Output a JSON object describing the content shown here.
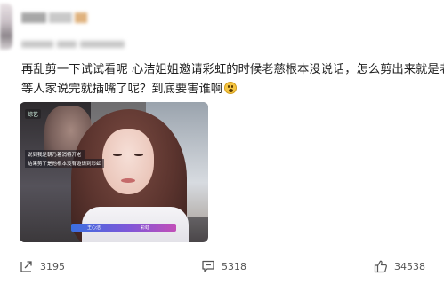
{
  "post": {
    "text_lines": [
      "再乱剪一下试试看呢 心洁姐姐邀请彩虹的时候老慈根本没说话，怎么剪出来就是老",
      "等人家说完就插嘴了呢？到底要害谁啊"
    ],
    "emoji": "astonished-face-emoji",
    "media": {
      "caption_tag": "综艺",
      "subtitle_1": "说到我是朝乃着消将开老",
      "subtitle_2": "结果剪了是他根本没有邀请到彩虹",
      "name_left": "王心洁",
      "name_right": "彩虹"
    }
  },
  "actions": {
    "share": {
      "icon": "share-icon",
      "count": "3195"
    },
    "comment": {
      "icon": "comment-icon",
      "count": "5318"
    },
    "like": {
      "icon": "thumbs-up-icon",
      "count": "34538"
    }
  }
}
